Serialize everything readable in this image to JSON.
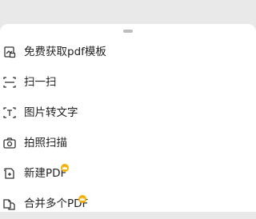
{
  "menu": {
    "items": [
      {
        "label": "免费获取pdf模板",
        "icon": "template-icon",
        "vip": false
      },
      {
        "label": "扫一扫",
        "icon": "scan-icon",
        "vip": false
      },
      {
        "label": "图片转文字",
        "icon": "image-to-text-icon",
        "vip": false
      },
      {
        "label": "拍照扫描",
        "icon": "camera-icon",
        "vip": false
      },
      {
        "label": "新建PDF",
        "icon": "new-pdf-icon",
        "vip": true
      },
      {
        "label": "合并多个PDF",
        "icon": "merge-pdf-icon",
        "vip": true
      }
    ]
  },
  "colors": {
    "vip_badge": "#f3b10a",
    "text": "#222222"
  }
}
